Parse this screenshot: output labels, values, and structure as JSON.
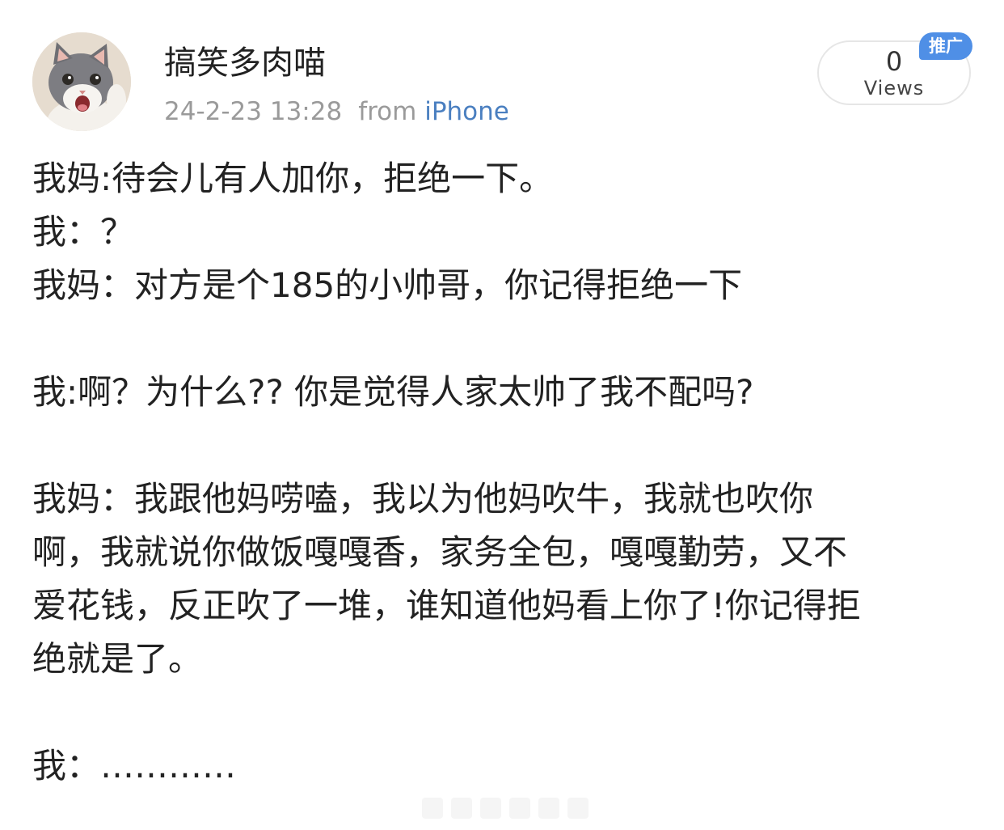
{
  "post": {
    "author": "搞笑多肉喵",
    "time": "24-2-23 13:28",
    "from_label": "from",
    "source": "iPhone",
    "views_count": "0",
    "views_label": "Views",
    "promo_badge": "推广",
    "lines": [
      "我妈:待会儿有人加你，拒绝一下。",
      "我：？",
      "我妈：对方是个185的小帅哥，你记得拒绝一下",
      "",
      "我:啊？为什么?? 你是觉得人家太帅了我不配吗?",
      "",
      "我妈：我跟他妈唠嗑，我以为他妈吹牛，我就也吹你",
      "啊，我就说你做饭嘎嘎香，家务全包，嘎嘎勤劳，又不",
      "爱花钱，反正吹了一堆，谁知道他妈看上你了!你记得拒",
      "绝就是了。",
      "",
      "我：…………"
    ]
  },
  "icons": {
    "avatar": "cat-avatar-icon"
  },
  "colors": {
    "text": "#222222",
    "meta": "#9a9a9a",
    "link": "#4a7fc0",
    "badge": "#4f8fe6"
  }
}
